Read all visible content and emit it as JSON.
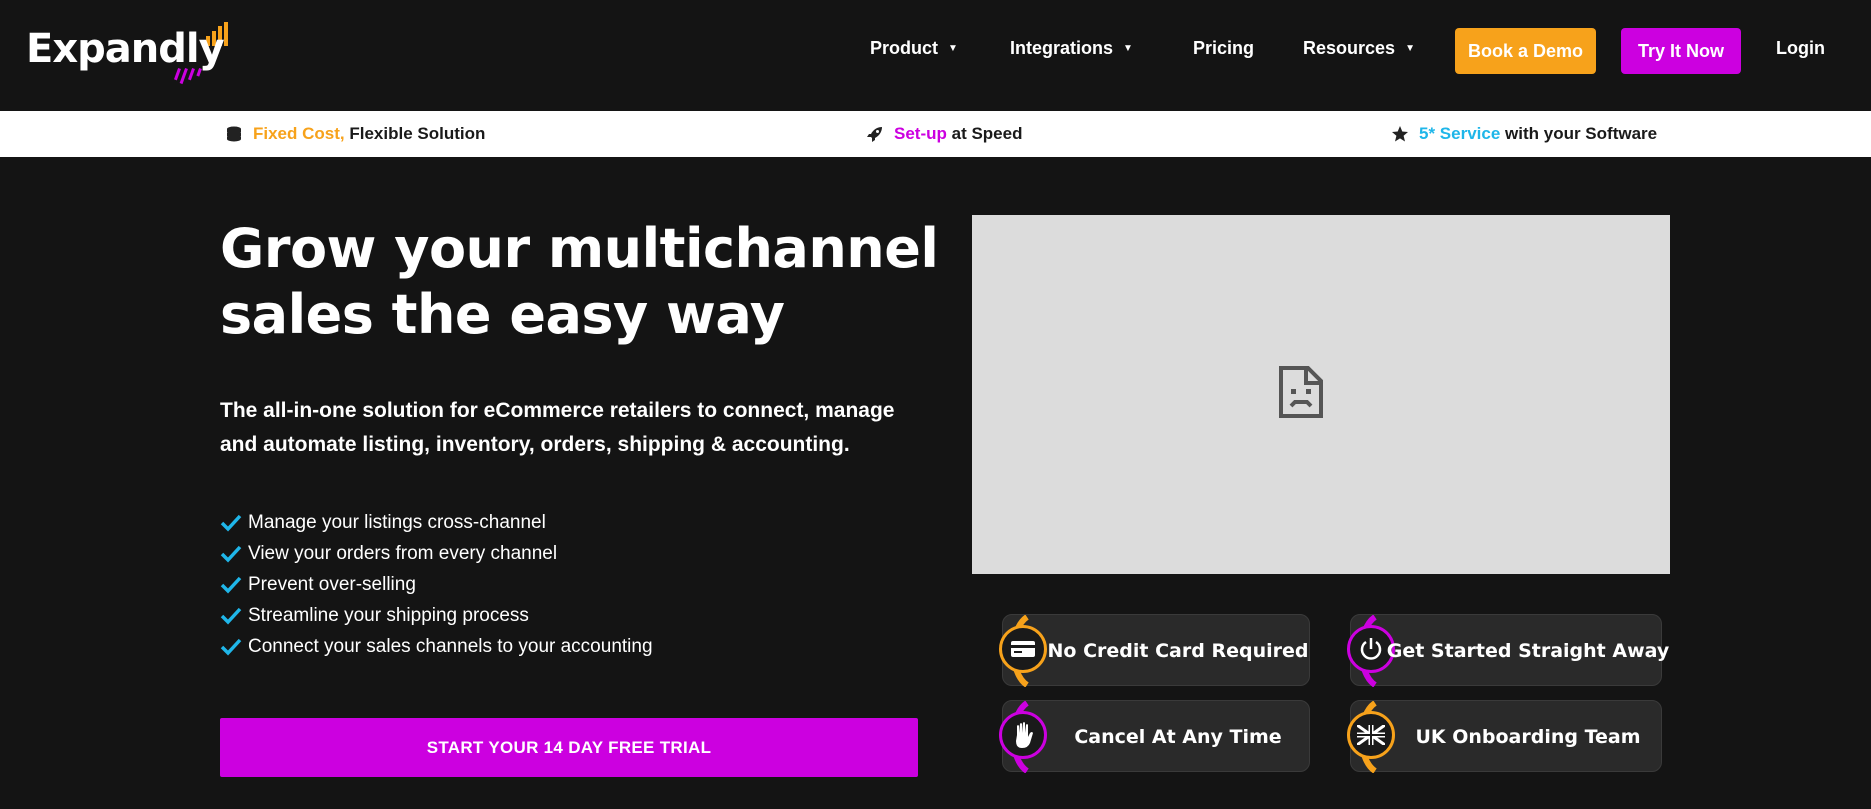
{
  "brand": {
    "name": "Expandly",
    "colors": {
      "orange": "#f7a21b",
      "magenta": "#cc00e0",
      "blue": "#1fb6e9"
    }
  },
  "nav": {
    "items": [
      {
        "label": "Product",
        "dropdown": true
      },
      {
        "label": "Integrations",
        "dropdown": true
      },
      {
        "label": "Pricing",
        "dropdown": false
      },
      {
        "label": "Resources",
        "dropdown": true
      }
    ],
    "book_demo": "Book a Demo",
    "try_now": "Try It Now",
    "login": "Login",
    "caret": "▼"
  },
  "strip": [
    {
      "icon": "coins-icon",
      "highlight": "Fixed Cost,",
      "text": "Flexible Solution",
      "color": "#f7a21b"
    },
    {
      "icon": "rocket-icon",
      "highlight": "Set-up",
      "text": "at Speed",
      "color": "#cc00e0"
    },
    {
      "icon": "star-icon",
      "highlight": "5* Service",
      "text": "with your Software",
      "color": "#1fb6e9"
    }
  ],
  "hero": {
    "headline_line1": "Grow your multichannel",
    "headline_line2": "sales the easy way",
    "subtext": "The all-in-one solution for eCommerce retailers to connect, manage and automate listing, inventory, orders, shipping & accounting.",
    "checklist": [
      "Manage your listings cross-channel",
      "View your orders from every channel",
      "Prevent over-selling",
      "Streamline your shipping process",
      "Connect your sales channels to your accounting"
    ],
    "cta": "START YOUR 14 DAY FREE TRIAL"
  },
  "badges": [
    {
      "label": "No Credit Card Required",
      "icon": "credit-card-icon",
      "color": "#f7a21b"
    },
    {
      "label": "Get Started Straight Away",
      "icon": "power-icon",
      "color": "#cc00e0"
    },
    {
      "label": "Cancel At Any Time",
      "icon": "hand-icon",
      "color": "#cc00e0"
    },
    {
      "label": "UK Onboarding Team",
      "icon": "uk-flag-icon",
      "color": "#f7a21b"
    }
  ]
}
